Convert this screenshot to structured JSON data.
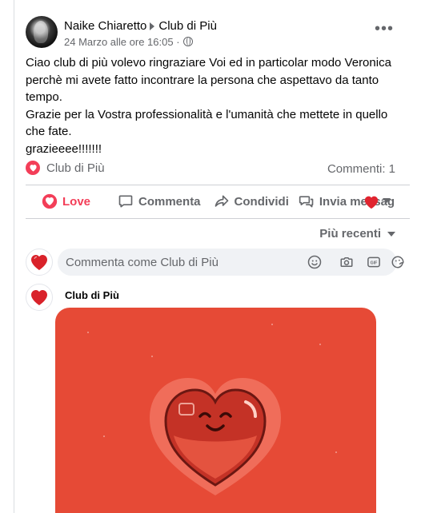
{
  "post": {
    "author": "Naike Chiaretto",
    "page": "Club di Più",
    "timestamp": "24 Marzo alle ore 16:05",
    "privacy_icon": "globe-icon",
    "more_icon": "more-dots-icon",
    "more_label": "•••",
    "text_lines": [
      "Ciao club di più volevo ringraziare Voi ed in particolar modo Veronica perchè mi avete fatto incontrare la persona che aspettavo da tanto tempo.",
      "Grazie per la Vostra professionalità e l'umanità che mettete in quello che fate.",
      "grazieeee!!!!!!!"
    ]
  },
  "reactions": {
    "reactor": "Club di Più",
    "comments_count": "Commenti: 1"
  },
  "actions": {
    "love": "Love",
    "comment": "Commenta",
    "share": "Condividi",
    "send": "Invia messag"
  },
  "sort": {
    "label": "Più recenti"
  },
  "comment_box": {
    "placeholder": "Commenta come Club di Più",
    "gif_label": "GIF"
  },
  "comment": {
    "author": "Club di Più"
  },
  "colors": {
    "love_red": "#f33e58",
    "gray_text": "#65676b",
    "sticker_bg": "#e64a36"
  }
}
